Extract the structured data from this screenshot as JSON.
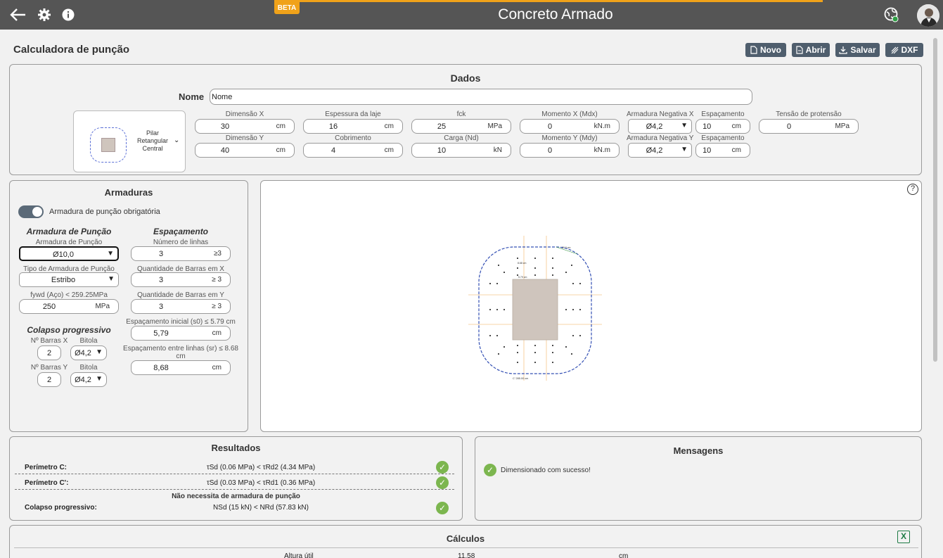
{
  "topbar": {
    "title": "Concreto Armado",
    "beta": "BETA"
  },
  "page": {
    "title": "Calculadora de punção"
  },
  "toolbar": {
    "novo": "Novo",
    "abrir": "Abrir",
    "salvar": "Salvar",
    "dxf": "DXF"
  },
  "dados": {
    "title": "Dados",
    "nome_label": "Nome",
    "nome_value": "Nome",
    "pilar": {
      "line1": "Pilar",
      "line2": "Retangular",
      "line3": "Central"
    },
    "dim_x": {
      "label": "Dimensão X",
      "value": "30",
      "unit": "cm"
    },
    "dim_y": {
      "label": "Dimensão Y",
      "value": "40",
      "unit": "cm"
    },
    "espessura": {
      "label": "Espessura da laje",
      "value": "16",
      "unit": "cm"
    },
    "cobrimento": {
      "label": "Cobrimento",
      "value": "4",
      "unit": "cm"
    },
    "fck": {
      "label": "fck",
      "value": "25",
      "unit": "MPa"
    },
    "carga": {
      "label": "Carga (Nd)",
      "value": "10",
      "unit": "kN"
    },
    "mom_x": {
      "label": "Momento X (Mdx)",
      "value": "0",
      "unit": "kN.m"
    },
    "mom_y": {
      "label": "Momento Y (Mdy)",
      "value": "0",
      "unit": "kN.m"
    },
    "arm_neg_x": {
      "label": "Armadura Negativa X",
      "value": "Ø4,2"
    },
    "arm_neg_y": {
      "label": "Armadura Negativa Y",
      "value": "Ø4,2"
    },
    "esp_x": {
      "label": "Espaçamento",
      "value": "10",
      "unit": "cm"
    },
    "esp_y": {
      "label": "Espaçamento",
      "value": "10",
      "unit": "cm"
    },
    "tensao": {
      "label": "Tensão de protensão",
      "value": "0",
      "unit": "MPa"
    }
  },
  "armaduras": {
    "title": "Armaduras",
    "toggle_label": "Armadura de punção obrigatória",
    "col1_title": "Armadura de Punção",
    "col2_title": "Espaçamento",
    "arm_puncao": {
      "label": "Armadura de Punção",
      "value": "Ø10,0"
    },
    "tipo": {
      "label": "Tipo de Armadura de Punção",
      "value": "Estribo"
    },
    "fywd": {
      "label": "fywd (Aço) < 259.25MPa",
      "value": "250",
      "unit": "MPa"
    },
    "num_linhas": {
      "label": "Número de linhas",
      "value": "3",
      "unit": "≥3"
    },
    "qtd_x": {
      "label": "Quantidade de Barras em X",
      "value": "3",
      "unit": "≥ 3"
    },
    "qtd_y": {
      "label": "Quantidade de Barras em Y",
      "value": "3",
      "unit": "≥ 3"
    },
    "s0": {
      "label": "Espaçamento inicial (s0) ≤ 5.79 cm",
      "value": "5,79",
      "unit": "cm"
    },
    "sr": {
      "label1": "Espaçamento entre linhas (sr) ≤ 8.68",
      "label2": "cm",
      "value": "8,68",
      "unit": "cm"
    },
    "colapso": {
      "title": "Colapso progressivo",
      "nbx_label": "Nº Barras X",
      "nbx_value": "2",
      "nby_label": "Nº Barras Y",
      "nby_value": "2",
      "bitola_label_x": "Bitola",
      "bitola_x": "Ø4,2",
      "bitola_label_y": "Bitola",
      "bitola_y": "Ø4,2"
    }
  },
  "drawing": {
    "help": "?",
    "label_sr": "8.68 cm",
    "label_s0": "5.79 cm",
    "label_corner": "20.0 cm",
    "label_perim": "C' 285.00 cm"
  },
  "resultados": {
    "title": "Resultados",
    "rows": [
      {
        "label": "Perímetro C:",
        "value": "τSd (0.06 MPa) < τRd2 (4.34 MPa)"
      },
      {
        "label": "Perímetro C':",
        "value": "τSd (0.03 MPa) < τRd1 (0.36 MPa)"
      }
    ],
    "nao_necessita": "Não necessita de armadura de punção",
    "colapso_label": "Colapso progressivo:",
    "colapso_value": "NSd (15 kN) < NRd (57.83 kN)"
  },
  "mensagens": {
    "title": "Mensagens",
    "msg": "Dimensionado com sucesso!"
  },
  "calculos": {
    "title": "Cálculos",
    "row_label": "Altura útil",
    "row_value": "11.58",
    "row_unit": "cm"
  },
  "colors": {
    "topbar": "#555555",
    "accent": "#f0a21a",
    "button": "#4f5e6d",
    "success": "#7cb64f"
  }
}
